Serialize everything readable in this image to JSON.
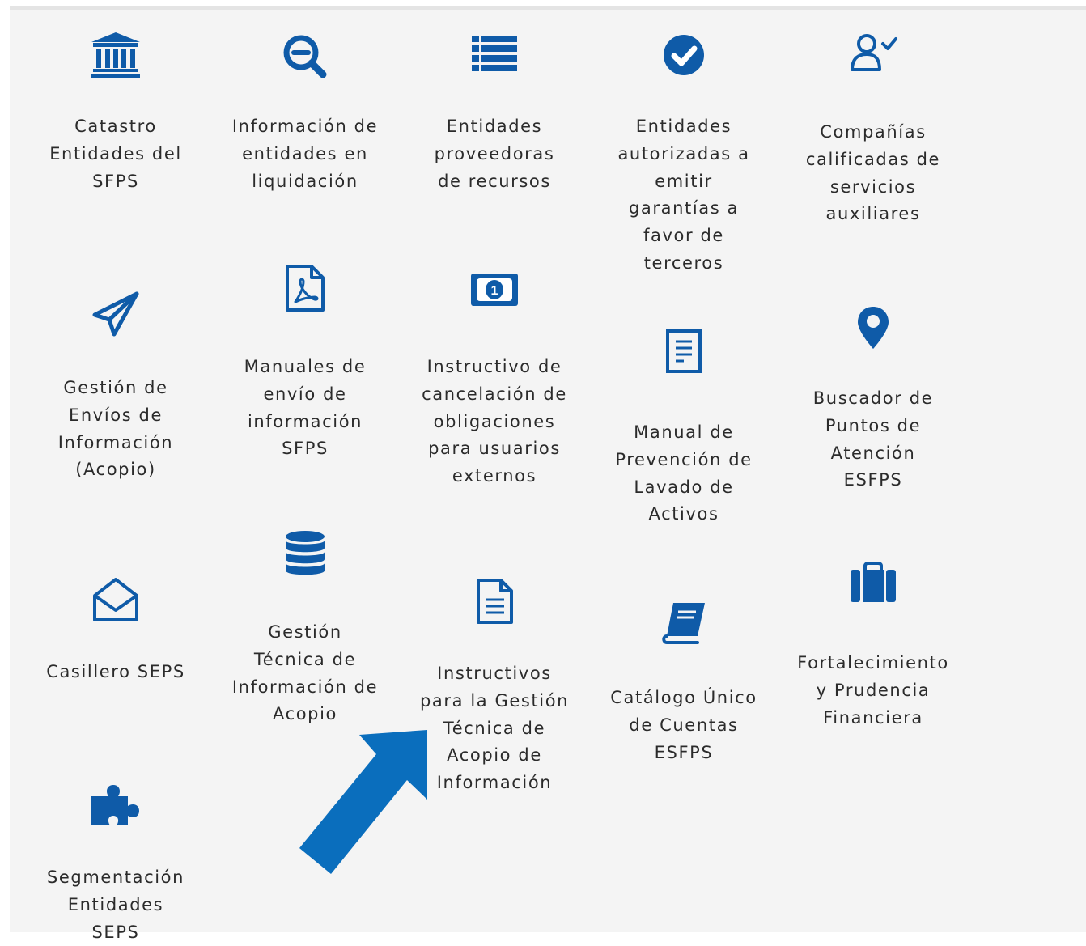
{
  "theme": {
    "icon_color": "#0f5ba8",
    "arrow_color": "#0a6ebd",
    "text_color": "#2b2b2b"
  },
  "tiles": [
    {
      "label": "Catastro\nEntidades del\nSFPS",
      "icon": "bank-icon"
    },
    {
      "label": "Información de\nentidades en\nliquidación",
      "icon": "zoom-out-icon"
    },
    {
      "label": "Entidades\nproveedoras\nde recursos",
      "icon": "list-icon"
    },
    {
      "label": "Entidades\nautorizadas a\nemitir\ngarantías a\nfavor de\nterceros",
      "icon": "check-circle-icon"
    },
    {
      "label": "Compañías\ncalificadas de\nservicios\nauxiliares",
      "icon": "user-check-icon"
    },
    {
      "label": "Gestión de\nEnvíos de\nInformación\n(Acopio)",
      "icon": "paper-plane-icon"
    },
    {
      "label": "Manuales de\nenvío de\ninformación\nSFPS",
      "icon": "pdf-file-icon"
    },
    {
      "label": "Instructivo de\ncancelación de\nobligaciones\npara usuarios\nexternos",
      "icon": "money-bill-icon"
    },
    {
      "label": "Manual de\nPrevención de\nLavado de\nActivos",
      "icon": "document-text-icon"
    },
    {
      "label": "Buscador de\nPuntos de\nAtención\nESFPS",
      "icon": "map-pin-icon"
    },
    {
      "label": "Casillero SEPS",
      "icon": "envelope-open-icon"
    },
    {
      "label": "Gestión\nTécnica de\nInformación de\nAcopio",
      "icon": "database-icon"
    },
    {
      "label": "Instructivos\npara la Gestión\nTécnica de\nAcopio de\nInformación",
      "icon": "file-lines-icon"
    },
    {
      "label": "Catálogo Único\nde Cuentas\nESFPS",
      "icon": "book-icon"
    },
    {
      "label": "Fortalecimiento\ny Prudencia\nFinanciera",
      "icon": "briefcase-icon"
    },
    {
      "label": "Segmentación\nEntidades\nSEPS",
      "icon": "puzzle-icon"
    }
  ],
  "annotation": {
    "icon": "arrow-pointer-icon"
  }
}
